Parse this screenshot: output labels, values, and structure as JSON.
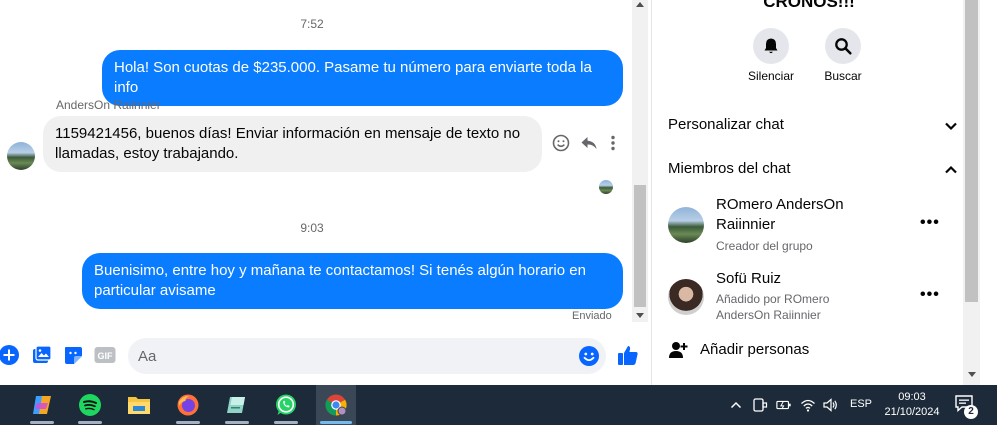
{
  "chat": {
    "time_1": "7:52",
    "msg_out_1": "Hola! Son cuotas de $235.000. Pasame tu número para enviarte toda la info",
    "sender_in_1": "AndersOn Raiinnier",
    "msg_in_1_line1": "1159421456, buenos días! Enviar información en mensaje de texto no",
    "msg_in_1_line2": "llamadas, estoy trabajando.",
    "time_2": "9:03",
    "msg_out_2_line1": "Buenisimo, entre hoy y mañana te contactamos! Si tenés algún horario en",
    "msg_out_2_line2": "particular avisame",
    "status": "Enviado"
  },
  "composer": {
    "placeholder": "Aa"
  },
  "side": {
    "group_title": "CRONOS!!!",
    "mute_label": "Silenciar",
    "search_label": "Buscar",
    "customize_label": "Personalizar chat",
    "members_label": "Miembros del chat",
    "members": [
      {
        "name_line1": "ROmero AndersOn",
        "name_line2": "Raiinnier",
        "sub_line1": "Creador del grupo",
        "sub_line2": ""
      },
      {
        "name_line1": "Sofü Ruiz",
        "name_line2": "",
        "sub_line1": "Añadido por ROmero",
        "sub_line2": "AndersOn Raiinnier"
      }
    ],
    "add_people_label": "Añadir personas"
  },
  "taskbar": {
    "apps": [
      "copilot-icon",
      "spotify-icon",
      "file-explorer-icon",
      "firefox-icon",
      "notes-app-icon",
      "whatsapp-icon",
      "chrome-icon"
    ],
    "active_app": "chrome-icon",
    "language": "ESP",
    "time": "09:03",
    "date": "21/10/2024",
    "notification_count": "2"
  },
  "colors": {
    "outgoing_bubble": "#0a7cff",
    "incoming_bubble": "#f0f0f0",
    "accent": "#0866ff",
    "taskbar": "#1c2a3a"
  }
}
